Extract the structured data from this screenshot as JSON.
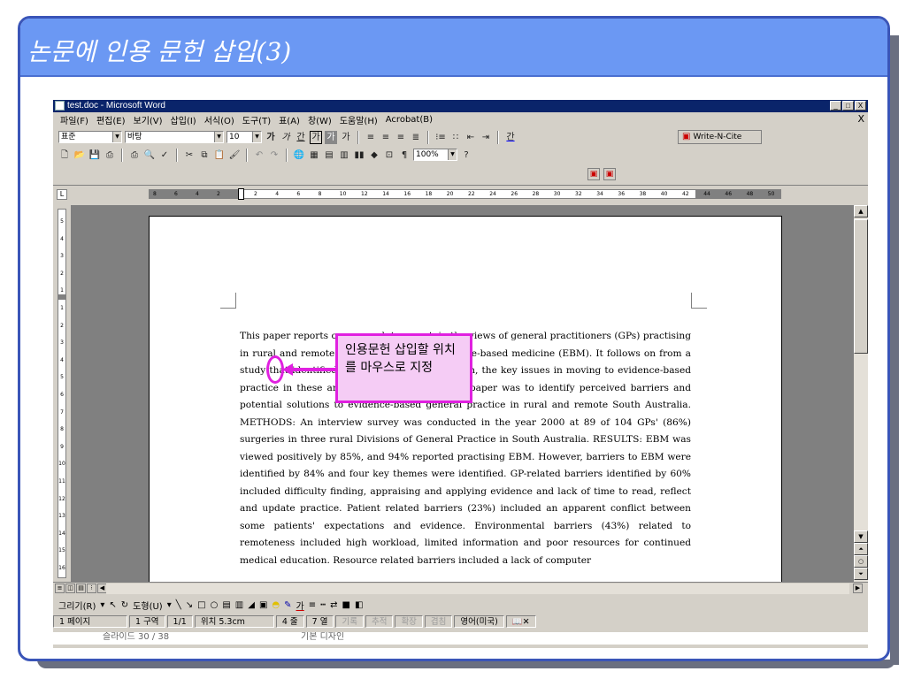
{
  "slide": {
    "title": "논문에 인용 문헌 삽입(3)"
  },
  "window": {
    "title": "test.doc - Microsoft Word",
    "controls": {
      "minimize": "_",
      "maximize": "□",
      "close": "X"
    },
    "doc_close": "X"
  },
  "menu": [
    {
      "label": "파일(F)"
    },
    {
      "label": "편집(E)"
    },
    {
      "label": "보기(V)"
    },
    {
      "label": "삽입(I)"
    },
    {
      "label": "서식(O)"
    },
    {
      "label": "도구(T)"
    },
    {
      "label": "표(A)"
    },
    {
      "label": "창(W)"
    },
    {
      "label": "도움말(H)"
    },
    {
      "label": "Acrobat(B)"
    }
  ],
  "format_toolbar": {
    "style_value": "표준",
    "font_value": "바탕",
    "size_value": "10",
    "bold": "가",
    "italic": "가",
    "underline": "간",
    "char_border": "가",
    "char_shade": "가",
    "char_scale": "가",
    "font_color": "간"
  },
  "standard_toolbar": {
    "zoom_value": "100%",
    "help": "?"
  },
  "writencite": {
    "label": "Write-N-Cite"
  },
  "ruler": {
    "left_ticks": [
      "8",
      "6",
      "4",
      "2"
    ],
    "right_ticks": [
      "2",
      "4",
      "6",
      "8",
      "10",
      "12",
      "14",
      "16",
      "18",
      "20",
      "22",
      "24",
      "26",
      "28",
      "30",
      "32",
      "34",
      "36",
      "38",
      "40",
      "42",
      "44",
      "46",
      "48",
      "50"
    ]
  },
  "vruler_ticks": [
    "5",
    "4",
    "3",
    "2",
    "1",
    "1",
    "2",
    "3",
    "4",
    "5",
    "6",
    "7",
    "8",
    "9",
    "10",
    "11",
    "12",
    "13",
    "14",
    "15",
    "16"
  ],
  "document": {
    "paragraph": "This paper reports on research to ascertain the views of general practitioners (GPs) practising in rural and remote South Australia, on evidence-based medicine (EBM). It follows on from a study that identified, through a literature search, the key issues in moving to evidence-based practice in these areas1. The objective of the paper was to identify perceived barriers and potential solutions to evidence-based general practice in rural and remote South Australia. METHODS: An interview survey was conducted in the year 2000 at 89 of 104 GPs' (86%) surgeries in three rural Divisions of General Practice in South Australia. RESULTS: EBM was viewed positively by 85%, and 94% reported practising EBM. However, barriers to EBM were identified by 84% and four key themes were identified. GP-related barriers identified by 60% included difficulty finding, appraising and applying evidence and lack of time to read, reflect and update practice. Patient related barriers (23%) included an apparent conflict between some patients' expectations and evidence. Environmental barriers (43%) related to remoteness included high workload, limited information and poor resources for continued medical education. Resource related barriers included a lack of computer"
  },
  "annotation": {
    "text": "인용문헌 삽입할 위치를 마우스로 지정"
  },
  "drawing_toolbar": {
    "draw": "그리기(R)",
    "autoshape": "도형(U)"
  },
  "status": {
    "page": "1 페이지",
    "section": "1 구역",
    "page_of": "1/1",
    "position": "위치 5.3cm",
    "line": "4 줄",
    "col": "7 열",
    "rec": "기록",
    "trk": "추적",
    "ext": "확장",
    "ovr": "겹침",
    "lang": "영어(미국)"
  },
  "ppt_status": {
    "slide": "슬라이드 30 / 38",
    "design": "기본 디자인"
  }
}
